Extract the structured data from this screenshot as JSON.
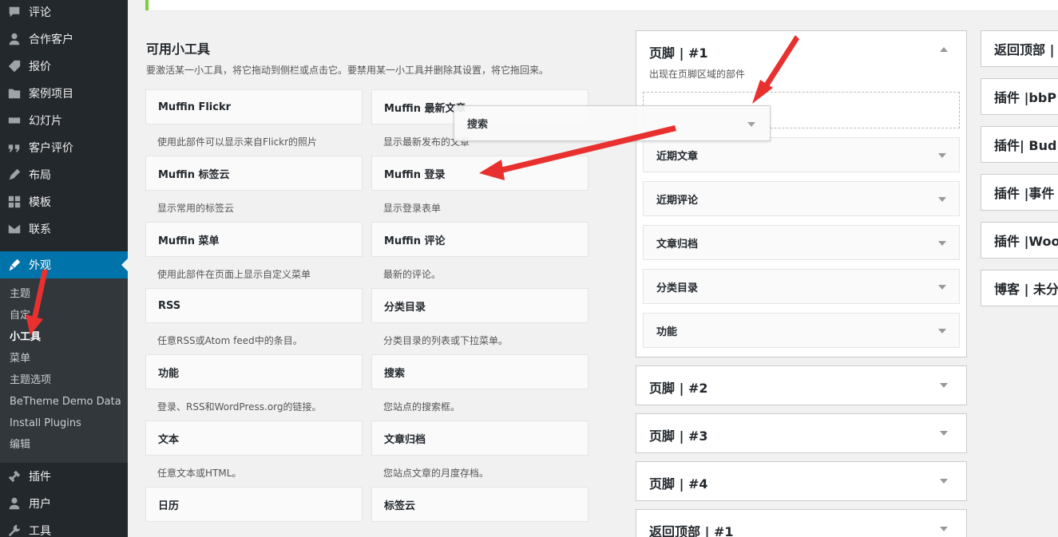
{
  "sidebar": {
    "items": [
      {
        "label": "评论",
        "icon": "comment-icon"
      },
      {
        "label": "合作客户",
        "icon": "user-icon"
      },
      {
        "label": "报价",
        "icon": "tag-icon"
      },
      {
        "label": "案例项目",
        "icon": "folder-icon"
      },
      {
        "label": "幻灯片",
        "icon": "slides-icon"
      },
      {
        "label": "客户评价",
        "icon": "quote-icon"
      },
      {
        "label": "布局",
        "icon": "pencil-icon"
      },
      {
        "label": "模板",
        "icon": "grid-icon"
      },
      {
        "label": "联系",
        "icon": "mail-icon"
      },
      {
        "label": "外观",
        "icon": "brush-icon"
      },
      {
        "label": "插件",
        "icon": "plugin-icon"
      },
      {
        "label": "用户",
        "icon": "user-icon"
      },
      {
        "label": "工具",
        "icon": "wrench-icon"
      }
    ],
    "submenu": [
      "主题",
      "自定",
      "小工具",
      "菜单",
      "主题选项",
      "BeTheme Demo Data",
      "Install Plugins",
      "编辑"
    ]
  },
  "available": {
    "title": "可用小工具",
    "description": "要激活某一小工具，将它拖动到侧栏或点击它。要禁用某一小工具并删除其设置，将它拖回来。",
    "widgets": [
      {
        "name": "Muffin Flickr",
        "desc": "使用此部件可以显示来自Flickr的照片"
      },
      {
        "name": "Muffin 最新文章",
        "desc": "显示最新发布的文章"
      },
      {
        "name": "Muffin 标签云",
        "desc": "显示常用的标签云"
      },
      {
        "name": "Muffin 登录",
        "desc": "显示登录表单"
      },
      {
        "name": "Muffin 菜单",
        "desc": "使用此部件在页面上显示自定义菜单"
      },
      {
        "name": "Muffin 评论",
        "desc": "最新的评论。"
      },
      {
        "name": "RSS",
        "desc": "任意RSS或Atom feed中的条目。"
      },
      {
        "name": "分类目录",
        "desc": "分类目录的列表或下拉菜单。"
      },
      {
        "name": "功能",
        "desc": "登录、RSS和WordPress.org的链接。"
      },
      {
        "name": "搜索",
        "desc": "您站点的搜索框。"
      },
      {
        "name": "文本",
        "desc": "任意文本或HTML。"
      },
      {
        "name": "文章归档",
        "desc": "您站点文章的月度存档。"
      },
      {
        "name": "日历",
        "desc": ""
      },
      {
        "name": "标签云",
        "desc": ""
      }
    ]
  },
  "areas": {
    "footer1": {
      "title": "页脚 | #1",
      "desc": "出现在页脚区域的部件",
      "widgets": [
        "近期文章",
        "近期评论",
        "文章归档",
        "分类目录",
        "功能"
      ]
    },
    "footer2": "页脚 | #2",
    "footer3": "页脚 | #3",
    "footer4": "页脚 | #4",
    "backtop1": "返回顶部 | #1"
  },
  "dragged": {
    "label": "搜索"
  },
  "right_areas": [
    "返回顶部 |",
    "插件 |bbP",
    "插件| Bud",
    "插件 |事件",
    "插件 |Woo",
    "博客 | 未分"
  ],
  "colors": {
    "sidebar_bg": "#23282d",
    "current": "#0073aa",
    "annotation": "#e8302f"
  }
}
